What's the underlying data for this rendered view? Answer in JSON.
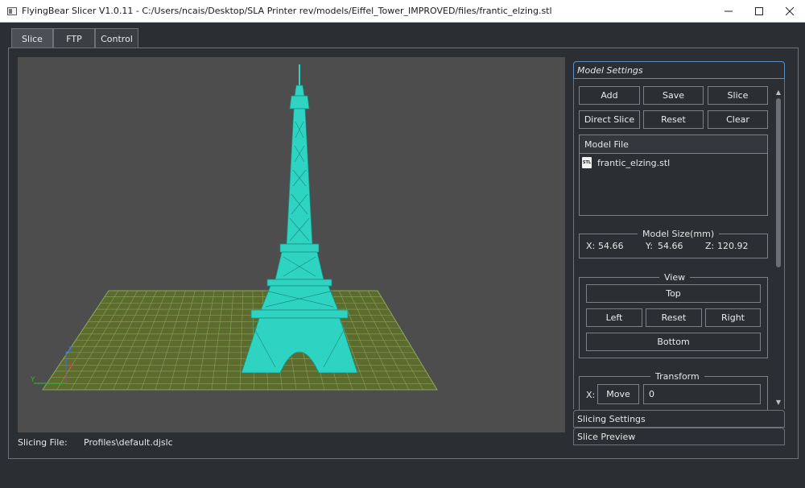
{
  "window": {
    "title": "FlyingBear Slicer V1.0.11 - C:/Users/ncais/Desktop/SLA Printer rev/models/Eiffel_Tower_IMPROVED/files/frantic_elzing.stl"
  },
  "tabs": [
    {
      "label": "Slice",
      "active": true
    },
    {
      "label": "FTP",
      "active": false
    },
    {
      "label": "Control",
      "active": false
    }
  ],
  "viewport": {
    "background": "#4d4d4d",
    "model_color": "#2ed3c2",
    "grid_color": "#8aa85a",
    "axes": {
      "z": "Z",
      "x": "X",
      "y": "Y"
    }
  },
  "status": {
    "slicing_file_label": "Slicing File:",
    "slicing_file_value": "Profiles\\default.djslc"
  },
  "panel": {
    "sections": {
      "model_settings": "Model Settings",
      "slicing_settings": "Slicing Settings",
      "slice_preview": "Slice Preview"
    },
    "buttons": {
      "add": "Add",
      "save": "Save",
      "slice": "Slice",
      "direct_slice": "Direct Slice",
      "reset": "Reset",
      "clear": "Clear"
    },
    "model_file": {
      "header": "Model File",
      "icon_text": "STL",
      "items": [
        "frantic_elzing.stl"
      ]
    },
    "model_size": {
      "title": "Model Size(mm)",
      "x_label": "X:",
      "x_value": "54.66",
      "y_label": "Y:",
      "y_value": "54.66",
      "z_label": "Z:",
      "z_value": "120.92"
    },
    "view": {
      "title": "View",
      "top": "Top",
      "left": "Left",
      "reset": "Reset",
      "right": "Right",
      "bottom": "Bottom"
    },
    "transform": {
      "title": "Transform",
      "x_label": "X:",
      "move": "Move",
      "move_value": "0"
    }
  }
}
